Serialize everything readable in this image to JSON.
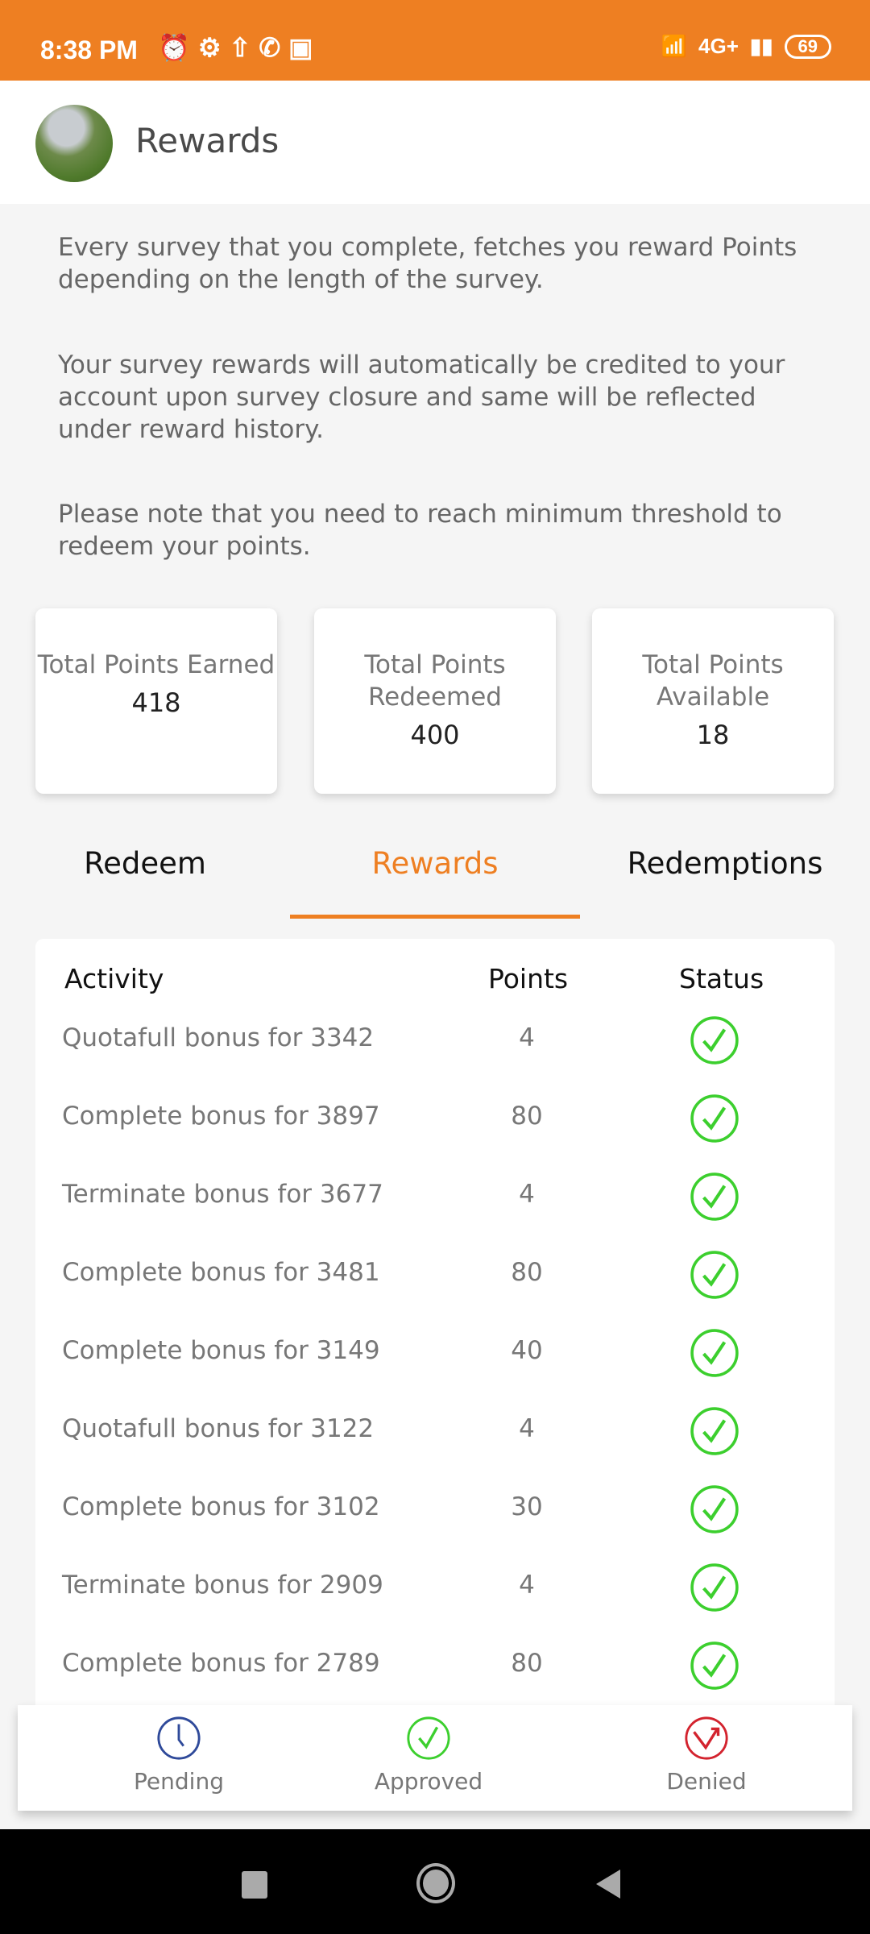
{
  "status_bar": {
    "time": "8:38 PM",
    "battery": "69",
    "network": "4G+"
  },
  "header": {
    "title": "Rewards"
  },
  "intro": [
    "Every survey that you complete, fetches you reward Points depending on the length of the survey.",
    "Your survey rewards will automatically be credited to your account upon survey closure and same will be reflected under reward history.",
    "Please note that you need to reach minimum threshold to redeem your points."
  ],
  "summary": [
    {
      "label": "Total Points Earned",
      "value": "418"
    },
    {
      "label": "Total Points Redeemed",
      "value": "400"
    },
    {
      "label": "Total Points Available",
      "value": "18"
    }
  ],
  "tabs": [
    {
      "label": "Redeem"
    },
    {
      "label": "Rewards",
      "active": true
    },
    {
      "label": "Redemptions"
    }
  ],
  "table": {
    "headers": [
      "Activity",
      "Points",
      "Status"
    ],
    "rows": [
      {
        "activity": "Quotafull bonus for 3342",
        "points": "4",
        "status": "approved"
      },
      {
        "activity": "Complete bonus for 3897",
        "points": "80",
        "status": "approved"
      },
      {
        "activity": "Terminate bonus for 3677",
        "points": "4",
        "status": "approved"
      },
      {
        "activity": "Complete bonus for 3481",
        "points": "80",
        "status": "approved"
      },
      {
        "activity": "Complete bonus for 3149",
        "points": "40",
        "status": "approved"
      },
      {
        "activity": "Quotafull bonus for 3122",
        "points": "4",
        "status": "approved"
      },
      {
        "activity": "Complete bonus for 3102",
        "points": "30",
        "status": "approved"
      },
      {
        "activity": "Terminate bonus for 2909",
        "points": "4",
        "status": "approved"
      },
      {
        "activity": "Complete bonus for 2789",
        "points": "80",
        "status": "approved"
      }
    ]
  },
  "legend": [
    {
      "label": "Pending",
      "icon": "clock-icon",
      "color": "#2f4a9a"
    },
    {
      "label": "Approved",
      "icon": "check-circle-icon",
      "color": "#3ccf2e"
    },
    {
      "label": "Denied",
      "icon": "denied-icon",
      "color": "#d3232e"
    }
  ],
  "colors": {
    "accent": "#ee7f22",
    "approved": "#3ccf2e"
  }
}
